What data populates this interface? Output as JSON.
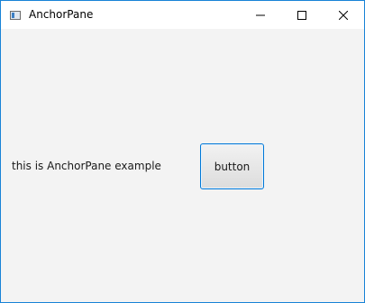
{
  "window": {
    "title": "AnchorPane",
    "icon": "javafx-app-icon"
  },
  "caption_buttons": {
    "minimize": "minimize-icon",
    "maximize": "maximize-icon",
    "close": "close-icon"
  },
  "content": {
    "label_text": "this is AnchorPane example",
    "button_label": "button"
  },
  "colors": {
    "window_border": "#1883d7",
    "content_background": "#f3f3f3",
    "button_focus_border": "#0078d7"
  }
}
